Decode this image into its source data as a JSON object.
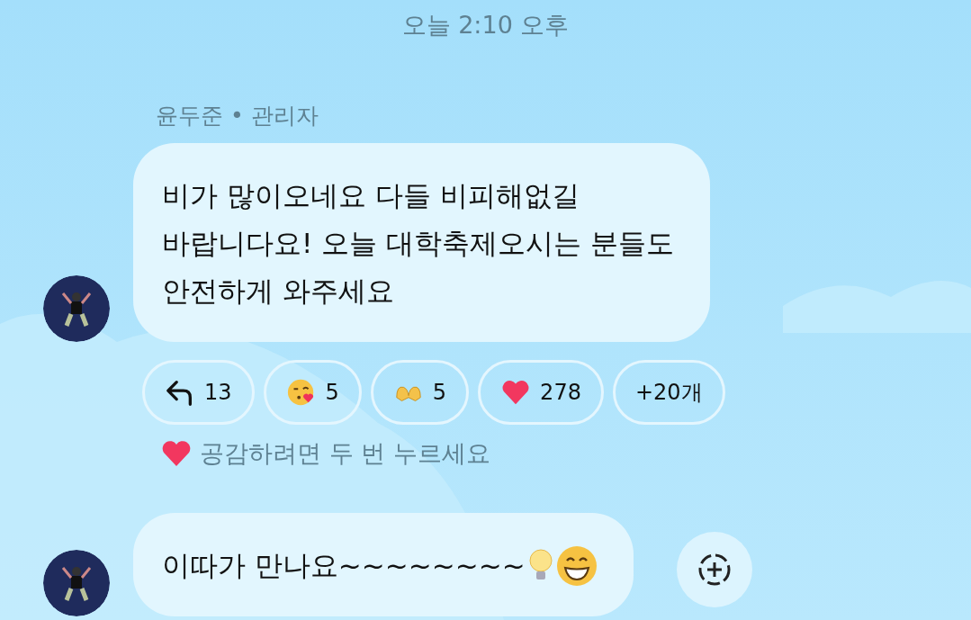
{
  "timestamp": "오늘 2:10 오후",
  "messages": [
    {
      "sender": "윤두준 • 관리자",
      "text": "비가 많이오네요 다들 비피해없길\n바랍니다요! 오늘 대학축제오시는 분들도\n안전하게 와주세요",
      "reactions": [
        {
          "kind": "reply",
          "count": "13"
        },
        {
          "kind": "kiss",
          "count": "5"
        },
        {
          "kind": "heart-hands",
          "count": "5"
        },
        {
          "kind": "heart",
          "count": "278"
        },
        {
          "kind": "more",
          "count": "+20개"
        }
      ],
      "hint": "공감하려면 두 번 누르세요"
    },
    {
      "text": "이따가 만나요~~~~~~~~",
      "emojis": [
        {
          "kind": "bulb"
        },
        {
          "kind": "grin"
        }
      ]
    }
  ]
}
